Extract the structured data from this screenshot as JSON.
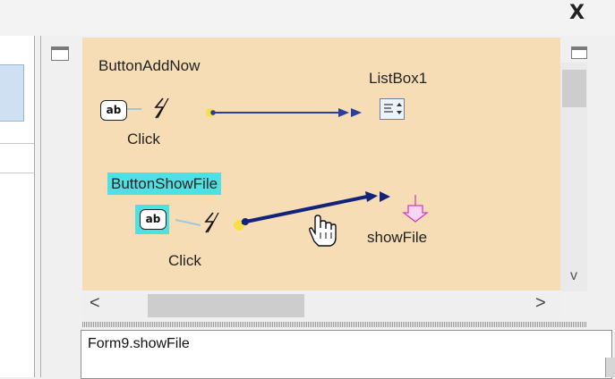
{
  "window": {
    "close_glyph": "X"
  },
  "canvas": {
    "button_add_now": {
      "label": "ButtonAddNow",
      "icon_text": "ab",
      "event": "Click"
    },
    "listbox": {
      "label": "ListBox1"
    },
    "button_show_file": {
      "label": "ButtonShowFile",
      "icon_text": "ab",
      "event": "Click"
    },
    "method": {
      "label": "showFile"
    }
  },
  "scrollbars": {
    "left_arrow": "<",
    "right_arrow": ">",
    "down_arrow": "v"
  },
  "status": {
    "text": "Form9.showFile"
  },
  "colors": {
    "canvas_bg": "#f6ddb6",
    "selection": "#4fe0e4",
    "wire_normal": "#2b3e9e",
    "wire_selected": "#12237a",
    "method_icon": "#d040c0"
  },
  "icons": [
    "close-icon",
    "resize-handle-icon",
    "textbox-ab-icon",
    "lightning-event-icon",
    "listbox-icon",
    "method-pin-icon",
    "hand-cursor-icon"
  ]
}
